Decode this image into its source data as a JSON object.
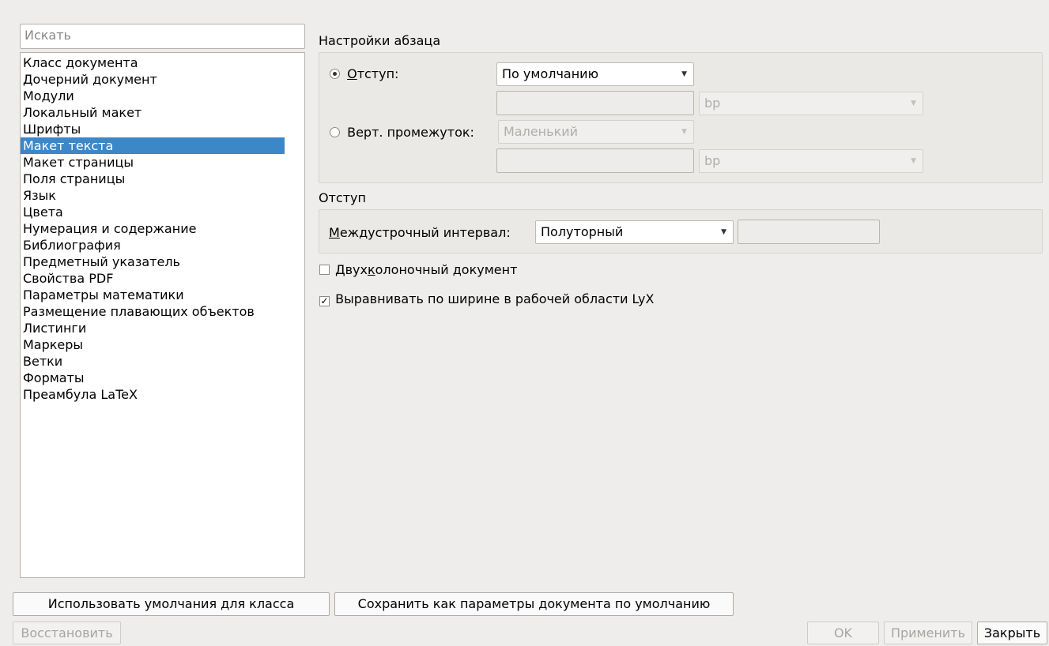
{
  "search": {
    "placeholder": "Искать"
  },
  "nav": {
    "items": [
      {
        "label": "Класс документа",
        "selected": false
      },
      {
        "label": "Дочерний документ",
        "selected": false
      },
      {
        "label": "Модули",
        "selected": false
      },
      {
        "label": "Локальный макет",
        "selected": false
      },
      {
        "label": "Шрифты",
        "selected": false
      },
      {
        "label": "Макет текста",
        "selected": true
      },
      {
        "label": "Макет страницы",
        "selected": false
      },
      {
        "label": "Поля страницы",
        "selected": false
      },
      {
        "label": "Язык",
        "selected": false
      },
      {
        "label": "Цвета",
        "selected": false
      },
      {
        "label": "Нумерация и содержание",
        "selected": false
      },
      {
        "label": "Библиография",
        "selected": false
      },
      {
        "label": "Предметный указатель",
        "selected": false
      },
      {
        "label": "Свойства PDF",
        "selected": false
      },
      {
        "label": "Параметры математики",
        "selected": false
      },
      {
        "label": "Размещение плавающих объектов",
        "selected": false
      },
      {
        "label": "Листинги",
        "selected": false
      },
      {
        "label": "Маркеры",
        "selected": false
      },
      {
        "label": "Ветки",
        "selected": false
      },
      {
        "label": "Форматы",
        "selected": false
      },
      {
        "label": "Преамбула LaTeX",
        "selected": false
      }
    ]
  },
  "paragraph": {
    "title": "Настройки абзаца",
    "indent_label_hotkey": "О",
    "indent_label_rest": "тступ:",
    "indent_selected": true,
    "indent_combo": "По умолчанию",
    "indent_unit": "bp",
    "vspace_label": "Верт. промежуток:",
    "vspace_selected": false,
    "vspace_combo": "Маленький",
    "vspace_unit": "bp"
  },
  "spacing": {
    "title": "Отступ",
    "line_label_hotkey": "М",
    "line_label_rest": "еждустрочный интервал:",
    "line_combo": "Полуторный"
  },
  "options": {
    "two_column_pre": "Двух",
    "two_column_hotkey": "к",
    "two_column_post": "олоночный документ",
    "two_column_checked": false,
    "justify_label": "Выравнивать по ширине в рабочей области LyX",
    "justify_checked": true
  },
  "buttons": {
    "use_class_defaults": "Использовать умолчания для класса",
    "save_as_defaults": "Сохранить как параметры документа по умолчанию",
    "restore": "Восстановить",
    "ok": "OK",
    "apply": "Применить",
    "close": "Закрыть"
  }
}
